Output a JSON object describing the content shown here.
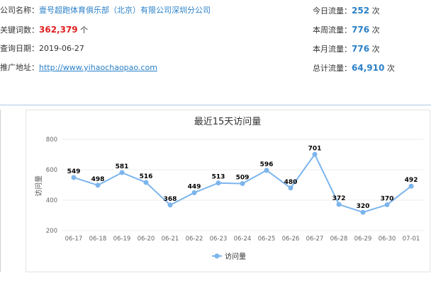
{
  "info": {
    "company_label": "公司名称：",
    "company_value": "壹号超跑体育俱乐部（北京）有限公司深圳分公司",
    "keywords_label": "关键词数：",
    "keywords_value": "362,379",
    "keywords_unit": "个",
    "date_label": "查询日期：",
    "date_value": "2019-06-27",
    "url_label": "推广地址：",
    "url_value": "http://www.yihaochaopao.com"
  },
  "traffic": {
    "today_label": "今日流量：",
    "today_value": "252",
    "week_label": "本周流量：",
    "week_value": "776",
    "month_label": "本月流量：",
    "month_value": "776",
    "total_label": "总计流量：",
    "total_value": "64,910",
    "unit": "次"
  },
  "colors": {
    "accent_blue": "#2a80c8",
    "highlight_red": "#e02020",
    "series_line": "#7cb5ec"
  },
  "chart_data": {
    "type": "line",
    "title": "最近15天访问量",
    "xlabel": "",
    "ylabel": "访问量",
    "categories": [
      "06-17",
      "06-18",
      "06-19",
      "06-20",
      "06-21",
      "06-22",
      "06-23",
      "06-24",
      "06-25",
      "06-26",
      "06-27",
      "06-28",
      "06-29",
      "06-30",
      "07-01"
    ],
    "series": [
      {
        "name": "访问量",
        "values": [
          549,
          498,
          581,
          516,
          368,
          449,
          513,
          509,
          596,
          480,
          701,
          372,
          320,
          370,
          492
        ]
      }
    ],
    "ylim": [
      200,
      800
    ],
    "yticks": [
      "800",
      "600",
      "400",
      "200"
    ],
    "grid": true,
    "legend": "bottom-center"
  }
}
